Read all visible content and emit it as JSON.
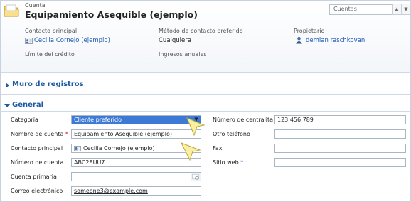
{
  "header": {
    "entity_label": "Cuenta",
    "record_title": "Equipamiento Asequible (ejemplo)",
    "view_selector": "Cuentas",
    "fields": {
      "primary_contact_label": "Contacto principal",
      "primary_contact_value": "Cecilia Cornejo (ejemplo)",
      "contact_method_label": "Método de contacto preferido",
      "contact_method_value": "Cualquiera",
      "owner_label": "Propietario",
      "owner_value": "demian raschkovan",
      "credit_limit_label": "Límite del crédito",
      "annual_revenue_label": "Ingresos anuales"
    }
  },
  "sections": {
    "wall": "Muro de registros",
    "general": "General"
  },
  "form": {
    "category_label": "Categoría",
    "category_value": "Cliente preferido",
    "account_name_label": "Nombre de cuenta",
    "account_name_value": "Equipamiento Asequible (ejemplo)",
    "primary_contact_label": "Contacto principal",
    "primary_contact_value": "Cecilia Cornejo (ejemplo)",
    "account_number_label": "Número de cuenta",
    "account_number_value": "ABC28UU7",
    "parent_account_label": "Cuenta primaria",
    "email_label": "Correo electrónico",
    "email_value": "someone3@example.com",
    "main_phone_label": "Número de centralita",
    "main_phone_value": "123 456 789",
    "other_phone_label": "Otro teléfono",
    "fax_label": "Fax",
    "website_label": "Sitio web",
    "required_mark": "*",
    "recommended_mark": "*"
  },
  "colors": {
    "section_heading": "#1c5aa0",
    "link": "#1f57b8",
    "selected_option": "#3d7ad6",
    "required": "#d11111"
  }
}
